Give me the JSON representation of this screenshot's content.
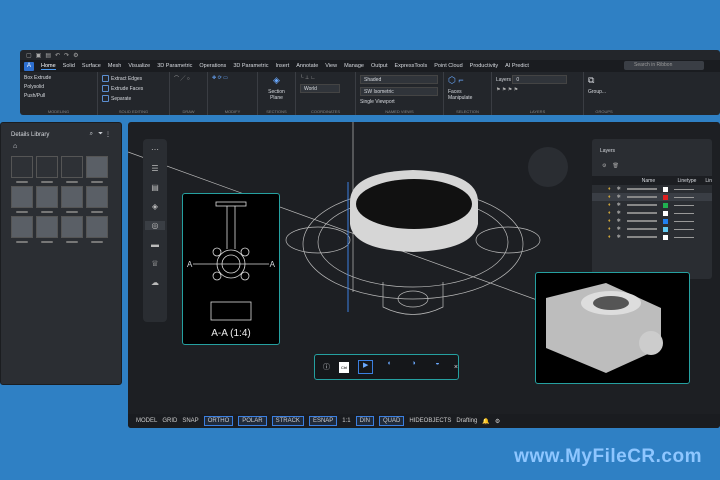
{
  "ribbon": {
    "tabs": [
      "Home",
      "Solid",
      "Surface",
      "Mesh",
      "Visualize",
      "3D Parametric",
      "Operations",
      "3D Parametric",
      "Insert",
      "Annotate",
      "View",
      "Manage",
      "Output",
      "ExpressTools",
      "Point Cloud",
      "Productivity",
      "AI Predict"
    ],
    "active_tab": "Home",
    "search_placeholder": "Search in Ribbon",
    "modeling": {
      "label": "MODELING",
      "box": "Box",
      "extrude": "Extrude",
      "polysolid": "Polysolid",
      "pushpull": "Push/Pull"
    },
    "solid_editing": {
      "label": "SOLID EDITING",
      "extract_edges": "Extract Edges",
      "extrude_faces": "Extrude Faces",
      "separate": "Separate"
    },
    "draw": {
      "label": "DRAW"
    },
    "modify": {
      "label": "MODIFY"
    },
    "sections": {
      "label": "SECTIONS",
      "section_plane": "Section Plane"
    },
    "coordinates": {
      "label": "COORDINATES",
      "ucs": "World"
    },
    "named_views": {
      "label": "NAMED VIEWS",
      "visual_style": "Shaded",
      "view": "SW Isometric",
      "viewport": "Single Viewport"
    },
    "selection": {
      "label": "SELECTION",
      "faces": "Faces",
      "manipulate": "Manipulate"
    },
    "layers": {
      "label": "LAYERS",
      "layers": "Layers",
      "current_layer": "0"
    },
    "groups": {
      "label": "GROUPS",
      "group": "Group..."
    }
  },
  "library": {
    "title": "Details Library"
  },
  "section_view": {
    "label": "A-A (1:4)",
    "marker": "A"
  },
  "layers_panel": {
    "title": "Layers",
    "columns": [
      "Name",
      "Linetype",
      "Lin"
    ],
    "colors": [
      "#ffffff",
      "#e02020",
      "#20b050",
      "#ffffff",
      "#2080f0",
      "#60c8f0",
      "#ffffff"
    ]
  },
  "bottom_toolbar": {
    "ctrl": "Ctrl",
    "close": "×"
  },
  "status": {
    "model": "MODEL",
    "grid": "GRID",
    "snap": "SNAP",
    "ortho": "ORTHO",
    "polar": "POLAR",
    "strack": "STRACK",
    "esnap": "ESNAP",
    "scale": "1:1",
    "din": "DIN",
    "quad": "QUAD",
    "hideobjects": "HIDEOBJECTS",
    "workspace": "Drafting"
  },
  "watermark": "www.MyFileCR.com"
}
